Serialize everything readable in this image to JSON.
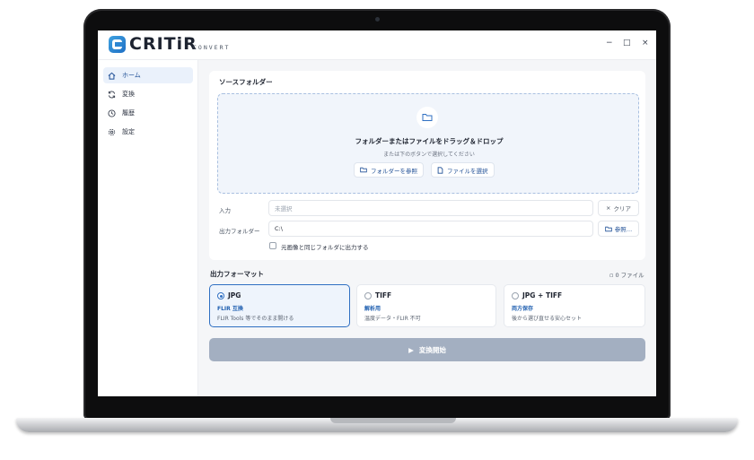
{
  "app": {
    "logo_text": "CRITiR",
    "logo_sub": "CONVERT",
    "window_controls": {
      "minimize": "−",
      "maximize": "□",
      "close": "×"
    }
  },
  "sidebar": {
    "items": [
      {
        "label": "ホーム",
        "icon": "home-icon",
        "active": true
      },
      {
        "label": "変換",
        "icon": "refresh-icon",
        "active": false
      },
      {
        "label": "履歴",
        "icon": "clock-icon",
        "active": false
      },
      {
        "label": "設定",
        "icon": "gear-icon",
        "active": false
      }
    ]
  },
  "source": {
    "title": "ソースフォルダー",
    "drop_title": "フォルダーまたはファイルをドラッグ＆ドロップ",
    "drop_sub": "または下のボタンで選択してください",
    "browse_folder": "フォルダーを参照",
    "select_file": "ファイルを選択",
    "input_label": "入力",
    "input_placeholder": "未選択",
    "clear_label": "クリア",
    "output_label": "出力フォルダー",
    "output_value": "C:\\",
    "browse_label": "参照…",
    "same_folder_label": "元画像と同じフォルダに出力する",
    "same_folder_checked": false
  },
  "output_format": {
    "title": "出力フォーマット",
    "file_count": "0 ファイル",
    "options": [
      {
        "name": "JPG",
        "tag": "FLIR 互換",
        "desc": "FLIR Tools 等でそのまま開ける",
        "selected": true
      },
      {
        "name": "TIFF",
        "tag": "解析用",
        "desc": "温度データ・FLIR 不可",
        "selected": false
      },
      {
        "name": "JPG + TIFF",
        "tag": "両方保存",
        "desc": "後から選び直せる安心セット",
        "selected": false
      }
    ]
  },
  "actions": {
    "convert_label": "変換開始"
  },
  "colors": {
    "accent": "#2f6fc2",
    "convert_disabled": "#a3afc1",
    "dropzone_bg": "#f1f5fb"
  }
}
